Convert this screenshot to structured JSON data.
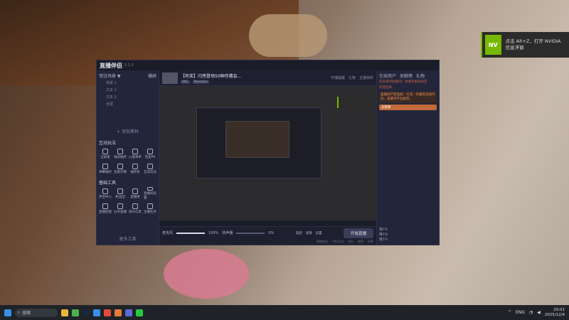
{
  "toast": {
    "text": "点击 Alt+Z，打开 NVIDIA 信息浮窗",
    "logo": "nvidia-logo"
  },
  "app": {
    "brand": "直播伴侣",
    "version": "5.1.3",
    "stream_title": "【有奖】闪亮登场50种你猜会...",
    "tags": [
      "PAC",
      "Reaction"
    ],
    "stats": [
      "开播提醒",
      "礼物",
      "主播资料"
    ],
    "sidebar": {
      "scene_label": "常驻场景 ▼",
      "scene_right": "横屏",
      "items": [
        "场景 1",
        "文本 1",
        "文本 2",
        "全屏"
      ],
      "add_label": "+ 添加素材",
      "tools_title": "互动玩法",
      "tools": [
        "全屏麦",
        "福袋抽奖",
        "心愿清单",
        "连麦PK",
        "弹幕抽奖",
        "连麦开播",
        "抽奖机",
        "互动玩法"
      ],
      "base_title": "基础工具",
      "base_tools": [
        "伴侣中心",
        "粉丝团",
        "直播榜",
        "直播间设置",
        "直播回放",
        "分享直播",
        "观众信息",
        "主播任务"
      ],
      "more": "更多工具"
    },
    "controls": {
      "mic_label": "麦克风",
      "mic_value": "100%",
      "speaker_label": "扬声器",
      "speaker_value": "0%",
      "buttons": [
        "美颜",
        "滤镜",
        "设置"
      ],
      "live_button": "开始直播"
    },
    "status": [
      "网络状况",
      "CPU占用",
      "内存",
      "帧率",
      "码率"
    ],
    "right": {
      "tabs": [
        "在线用户",
        "贡献榜",
        "礼物"
      ],
      "chat": [
        "欢迎来到直播间！请遵守相关规定",
        "欢迎回来..."
      ],
      "notice": "直播间严禁低俗、引流、诈骗等违规行为，请遵守平台规范。",
      "gift_label": "去看看",
      "users": [
        "用户1",
        "用户2",
        "用户3"
      ]
    }
  },
  "taskbar": {
    "search": "搜索",
    "lang": "ENG",
    "time": "20:01",
    "date": "2025/12/4"
  }
}
